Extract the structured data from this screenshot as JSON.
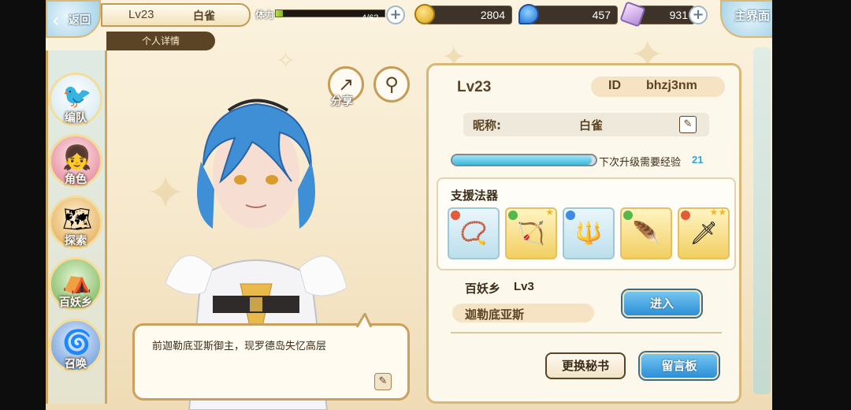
{
  "topbar": {
    "back_label": "返回",
    "level": "Lv23",
    "player_name": "白雀",
    "subtab_label": "个人详情",
    "stamina_label": "体力",
    "stamina_text": "4/62",
    "stamina_fraction": 0.065,
    "gold": "2804",
    "soul": "457",
    "crystal": "931",
    "home_label": "主界面"
  },
  "nav": {
    "items": [
      {
        "label": "编队",
        "icon": "team-icon"
      },
      {
        "label": "角色",
        "icon": "character-icon"
      },
      {
        "label": "探索",
        "icon": "explore-icon"
      },
      {
        "label": "百妖乡",
        "icon": "village-icon"
      },
      {
        "label": "召唤",
        "icon": "summon-icon"
      }
    ]
  },
  "actions": {
    "share_label": "分享"
  },
  "speech": {
    "text": "前迦勒底亚斯御主，现罗德岛失忆高层"
  },
  "profile": {
    "level": "Lv23",
    "id_key": "ID",
    "id_value": "bhzj3nm",
    "nickname_label": "昵称:",
    "nickname_value": "白雀",
    "exp_label": "下次升级需要经验",
    "exp_value": "21",
    "exp_fraction": 0.97,
    "support_title": "支援法器",
    "weapons": [
      {
        "icon": "bracelet-icon",
        "element": "fire",
        "element_color": "#e35b3b"
      },
      {
        "icon": "crossbow-icon",
        "element": "wind",
        "element_color": "#54b94a"
      },
      {
        "icon": "spear-icon",
        "element": "water",
        "element_color": "#3b8de3"
      },
      {
        "icon": "wing-blade-icon",
        "element": "wind",
        "element_color": "#54b94a"
      },
      {
        "icon": "dark-sword-icon",
        "element": "fire",
        "element_color": "#e35b3b"
      }
    ],
    "village_label": "百妖乡",
    "village_level": "Lv3",
    "village_name": "迦勒底亚斯",
    "enter_label": "进入",
    "change_secretary_label": "更换秘书",
    "message_board_label": "留言板"
  },
  "colors": {
    "accent_blue": "#2c8fd6",
    "frame_gold": "#d8b878",
    "text_brown": "#5b4425"
  }
}
